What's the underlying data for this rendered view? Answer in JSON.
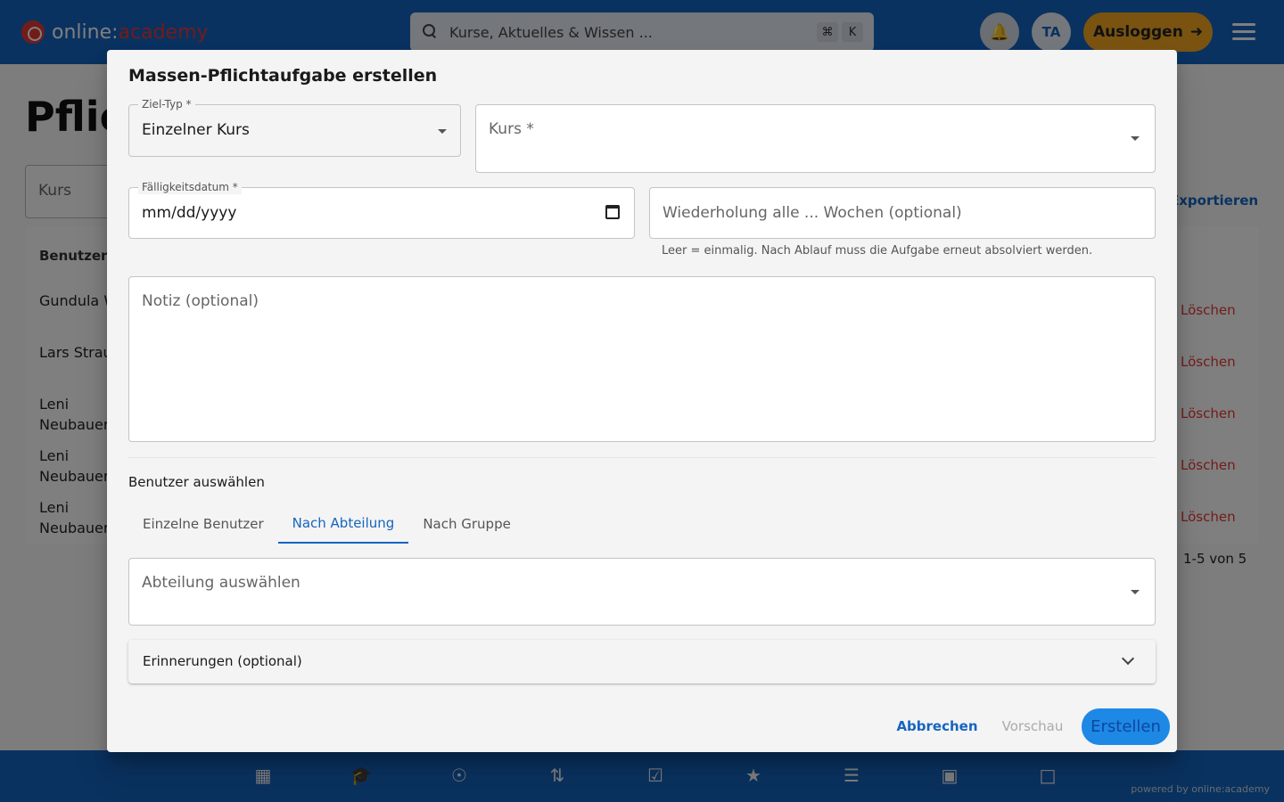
{
  "app": {
    "logo_prefix": "online:",
    "logo_accent": "academy",
    "search_placeholder": "Kurse, Aktuelles & Wissen ...",
    "search_kbd_1": "⌘",
    "search_kbd_2": "K",
    "avatar_initials": "TA",
    "logout_label": "Ausloggen",
    "powered_by": "powered by online:academy"
  },
  "background_page": {
    "title": "Pflicl",
    "filter_label": "Kurs",
    "export_label": "Exportieren",
    "table_header": "Benutzer",
    "rows": [
      {
        "name": "Gundula Wolf",
        "action": "Löschen"
      },
      {
        "name": "Lars Straub",
        "action": "Löschen"
      },
      {
        "name": "Leni Neubauer",
        "action": "Löschen"
      },
      {
        "name": "Leni Neubauer",
        "action": "Löschen"
      },
      {
        "name": "Leni Neubauer",
        "action": "Löschen"
      }
    ],
    "pagination": "1-5 von 5"
  },
  "dialog": {
    "title": "Massen-Pflichtaufgabe erstellen",
    "ziel_typ": {
      "label": "Ziel-Typ *",
      "value": "Einzelner Kurs"
    },
    "kurs": {
      "placeholder": "Kurs *"
    },
    "datum": {
      "label": "Fälligkeitsdatum *",
      "value": "mm/dd/yyyy"
    },
    "wiederholung": {
      "placeholder": "Wiederholung alle ... Wochen (optional)",
      "helper": "Leer = einmalig. Nach Ablauf muss die Aufgabe erneut absolviert werden."
    },
    "notiz": {
      "placeholder": "Notiz (optional)"
    },
    "benutzer_section": "Benutzer auswählen",
    "tabs": [
      "Einzelne Benutzer",
      "Nach Abteilung",
      "Nach Gruppe"
    ],
    "active_tab": "Nach Abteilung",
    "abteilung": {
      "placeholder": "Abteilung auswählen"
    },
    "erinnerungen": "Erinnerungen (optional)",
    "buttons": {
      "cancel": "Abbrechen",
      "preview": "Vorschau",
      "create": "Erstellen"
    }
  },
  "colors": {
    "primary": "#1565c0",
    "accent": "#f5a623",
    "danger": "#e53935"
  },
  "icons": {
    "bottom_nav": [
      "dashboard-icon",
      "courses-icon",
      "explore-icon",
      "paths-icon",
      "tasks-icon",
      "awards-icon",
      "articles-icon",
      "media-icon",
      "folder-icon"
    ]
  }
}
